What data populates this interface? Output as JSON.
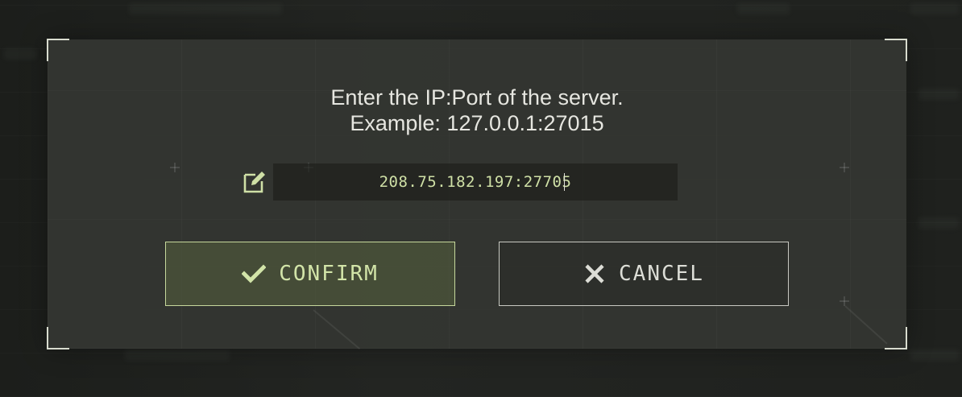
{
  "dialog": {
    "prompt_line1": "Enter the IP:Port of the server.",
    "prompt_line2": "Example: 127.0.0.1:27015",
    "input": {
      "value": "208.75.182.197:27705",
      "icon": "edit-icon"
    },
    "confirm_button": {
      "label": "CONFIRM",
      "icon": "checkmark-icon"
    },
    "cancel_button": {
      "label": "CANCEL",
      "icon": "close-icon"
    }
  },
  "colors": {
    "accent": "#c6d89c",
    "input_text": "#cfe0a6",
    "text": "#e6e6e0"
  }
}
